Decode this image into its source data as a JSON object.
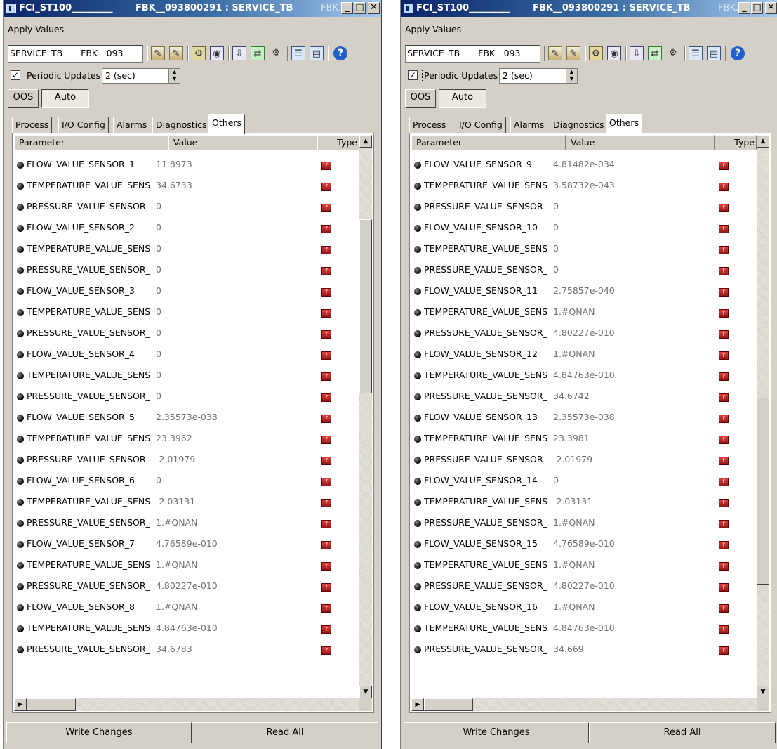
{
  "windows": [
    {
      "title_left": "FCI_ST100_________",
      "title_mid": "FBK__093800291 : SERVICE_TB",
      "title_right": "FBK...",
      "menu": "Apply Values",
      "combo": [
        "SERVICE_TB",
        "FBK__093"
      ],
      "periodic_label": "Periodic Updates",
      "periodic_interval": "2 (sec)",
      "mode_oos": "OOS",
      "mode_auto": "Auto",
      "tabs": [
        "Process",
        "I/O Config",
        "Alarms",
        "Diagnostics",
        "Others"
      ],
      "active_tab": "Others",
      "columns": [
        "Parameter",
        "Value",
        "Type"
      ],
      "rows": [
        {
          "name": "FLOW_VALUE_SENSOR_1",
          "value": "11.8973"
        },
        {
          "name": "TEMPERATURE_VALUE_SENS",
          "value": "34.6733"
        },
        {
          "name": "PRESSURE_VALUE_SENSOR_",
          "value": "0"
        },
        {
          "name": "FLOW_VALUE_SENSOR_2",
          "value": "0"
        },
        {
          "name": "TEMPERATURE_VALUE_SENS",
          "value": "0"
        },
        {
          "name": "PRESSURE_VALUE_SENSOR_",
          "value": "0"
        },
        {
          "name": "FLOW_VALUE_SENSOR_3",
          "value": "0"
        },
        {
          "name": "TEMPERATURE_VALUE_SENS",
          "value": "0"
        },
        {
          "name": "PRESSURE_VALUE_SENSOR_",
          "value": "0"
        },
        {
          "name": "FLOW_VALUE_SENSOR_4",
          "value": "0"
        },
        {
          "name": "TEMPERATURE_VALUE_SENS",
          "value": "0"
        },
        {
          "name": "PRESSURE_VALUE_SENSOR_",
          "value": "0"
        },
        {
          "name": "FLOW_VALUE_SENSOR_5",
          "value": "2.35573e-038"
        },
        {
          "name": "TEMPERATURE_VALUE_SENS",
          "value": "23.3962"
        },
        {
          "name": "PRESSURE_VALUE_SENSOR_",
          "value": "-2.01979"
        },
        {
          "name": "FLOW_VALUE_SENSOR_6",
          "value": "0"
        },
        {
          "name": "TEMPERATURE_VALUE_SENS",
          "value": "-2.03131"
        },
        {
          "name": "PRESSURE_VALUE_SENSOR_",
          "value": "1.#QNAN"
        },
        {
          "name": "FLOW_VALUE_SENSOR_7",
          "value": "4.76589e-010"
        },
        {
          "name": "TEMPERATURE_VALUE_SENS",
          "value": "1.#QNAN"
        },
        {
          "name": "PRESSURE_VALUE_SENSOR_",
          "value": "4.80227e-010"
        },
        {
          "name": "FLOW_VALUE_SENSOR_8",
          "value": "1.#QNAN"
        },
        {
          "name": "TEMPERATURE_VALUE_SENS",
          "value": "4.84763e-010"
        },
        {
          "name": "PRESSURE_VALUE_SENSOR_",
          "value": "34.6783"
        }
      ],
      "write_label": "Write Changes",
      "read_label": "Read All"
    },
    {
      "title_left": "FCI_ST100_________",
      "title_mid": "FBK__093800291 : SERVICE_TB",
      "title_right": "FBK...",
      "menu": "Apply Values",
      "combo": [
        "SERVICE_TB",
        "FBK__093"
      ],
      "periodic_label": "Periodic Updates",
      "periodic_interval": "2 (sec)",
      "mode_oos": "OOS",
      "mode_auto": "Auto",
      "tabs": [
        "Process",
        "I/O Config",
        "Alarms",
        "Diagnostics",
        "Others"
      ],
      "active_tab": "Others",
      "columns": [
        "Parameter",
        "Value",
        "Type"
      ],
      "rows": [
        {
          "name": "FLOW_VALUE_SENSOR_9",
          "value": "4.81482e-034"
        },
        {
          "name": "TEMPERATURE_VALUE_SENS",
          "value": "3.58732e-043"
        },
        {
          "name": "PRESSURE_VALUE_SENSOR_",
          "value": "0"
        },
        {
          "name": "FLOW_VALUE_SENSOR_10",
          "value": "0"
        },
        {
          "name": "TEMPERATURE_VALUE_SENS",
          "value": "0"
        },
        {
          "name": "PRESSURE_VALUE_SENSOR_",
          "value": "0"
        },
        {
          "name": "FLOW_VALUE_SENSOR_11",
          "value": "2.75857e-040"
        },
        {
          "name": "TEMPERATURE_VALUE_SENS",
          "value": "1.#QNAN"
        },
        {
          "name": "PRESSURE_VALUE_SENSOR_",
          "value": "4.80227e-010"
        },
        {
          "name": "FLOW_VALUE_SENSOR_12",
          "value": "1.#QNAN"
        },
        {
          "name": "TEMPERATURE_VALUE_SENS",
          "value": "4.84763e-010"
        },
        {
          "name": "PRESSURE_VALUE_SENSOR_",
          "value": "34.6742"
        },
        {
          "name": "FLOW_VALUE_SENSOR_13",
          "value": "2.35573e-038"
        },
        {
          "name": "TEMPERATURE_VALUE_SENS",
          "value": "23.3981"
        },
        {
          "name": "PRESSURE_VALUE_SENSOR_",
          "value": "-2.01979"
        },
        {
          "name": "FLOW_VALUE_SENSOR_14",
          "value": "0"
        },
        {
          "name": "TEMPERATURE_VALUE_SENS",
          "value": "-2.03131"
        },
        {
          "name": "PRESSURE_VALUE_SENSOR_",
          "value": "1.#QNAN"
        },
        {
          "name": "FLOW_VALUE_SENSOR_15",
          "value": "4.76589e-010"
        },
        {
          "name": "TEMPERATURE_VALUE_SENS",
          "value": "1.#QNAN"
        },
        {
          "name": "PRESSURE_VALUE_SENSOR_",
          "value": "4.80227e-010"
        },
        {
          "name": "FLOW_VALUE_SENSOR_16",
          "value": "1.#QNAN"
        },
        {
          "name": "TEMPERATURE_VALUE_SENS",
          "value": "4.84763e-010"
        },
        {
          "name": "PRESSURE_VALUE_SENSOR_",
          "value": "34.669"
        }
      ],
      "write_label": "Write Changes",
      "read_label": "Read All"
    }
  ]
}
